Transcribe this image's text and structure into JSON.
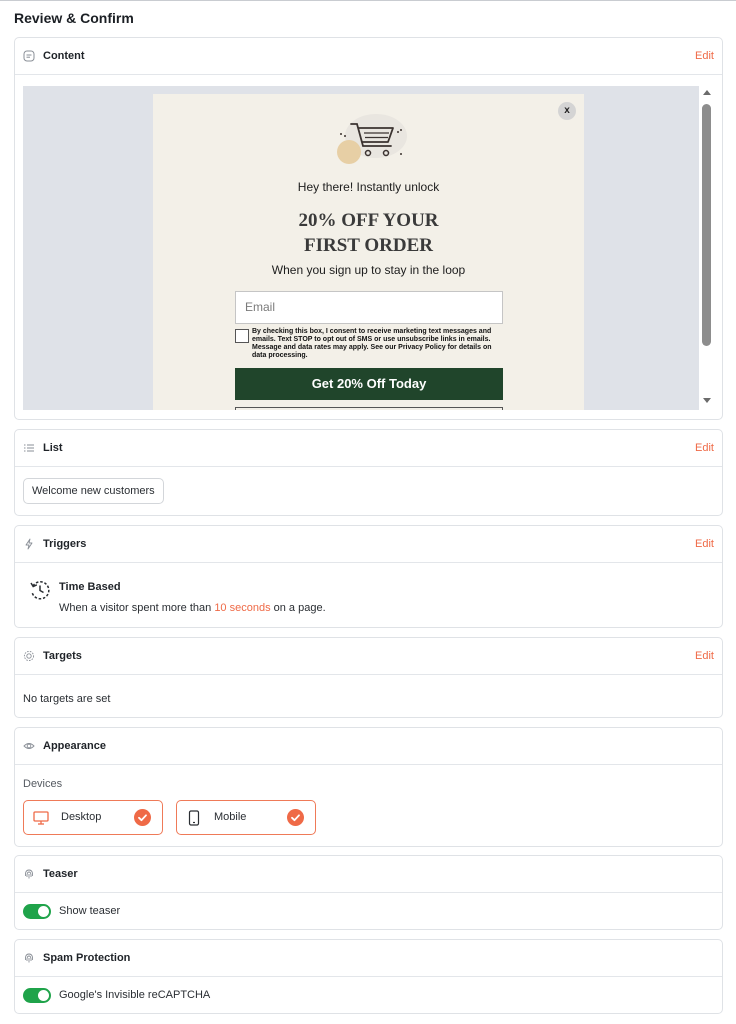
{
  "page": {
    "title": "Review & Confirm"
  },
  "content": {
    "title": "Content",
    "edit_label": "Edit",
    "popup": {
      "close_label": "x",
      "hey_text": "Hey there! Instantly unlock",
      "headline_line1": "20% OFF YOUR",
      "headline_line2": "FIRST ORDER",
      "subline": "When you sign up to stay in the loop",
      "email_placeholder": "Email",
      "consent_text": "By checking this box, I consent to receive marketing text messages and emails. Text STOP to opt out of SMS or use unsubscribe links in emails. Message and data rates may apply. See our Privacy Policy for details on data processing.",
      "cta_label": "Get 20% Off Today",
      "cta_color": "#20452b",
      "background_color": "#f3f0e8"
    }
  },
  "list": {
    "title": "List",
    "edit_label": "Edit",
    "selected": "Welcome new customers"
  },
  "triggers": {
    "title": "Triggers",
    "edit_label": "Edit",
    "item_title": "Time Based",
    "desc_prefix": "When a visitor spent more than",
    "desc_highlight": "10 seconds",
    "desc_suffix": "on a page."
  },
  "targets": {
    "title": "Targets",
    "edit_label": "Edit",
    "empty_text": "No targets are set"
  },
  "appearance": {
    "title": "Appearance",
    "devices_label": "Devices",
    "devices": [
      {
        "label": "Desktop",
        "icon": "desktop-icon",
        "checked": true
      },
      {
        "label": "Mobile",
        "icon": "mobile-icon",
        "checked": true
      }
    ]
  },
  "teaser": {
    "title": "Teaser",
    "toggle_label": "Show teaser",
    "enabled": true
  },
  "spam": {
    "title": "Spam Protection",
    "toggle_label": "Google's Invisible reCAPTCHA",
    "enabled": true
  },
  "colors": {
    "accent": "#ef6a47",
    "toggle_on": "#1fa34a",
    "border": "#dfe2e6"
  }
}
